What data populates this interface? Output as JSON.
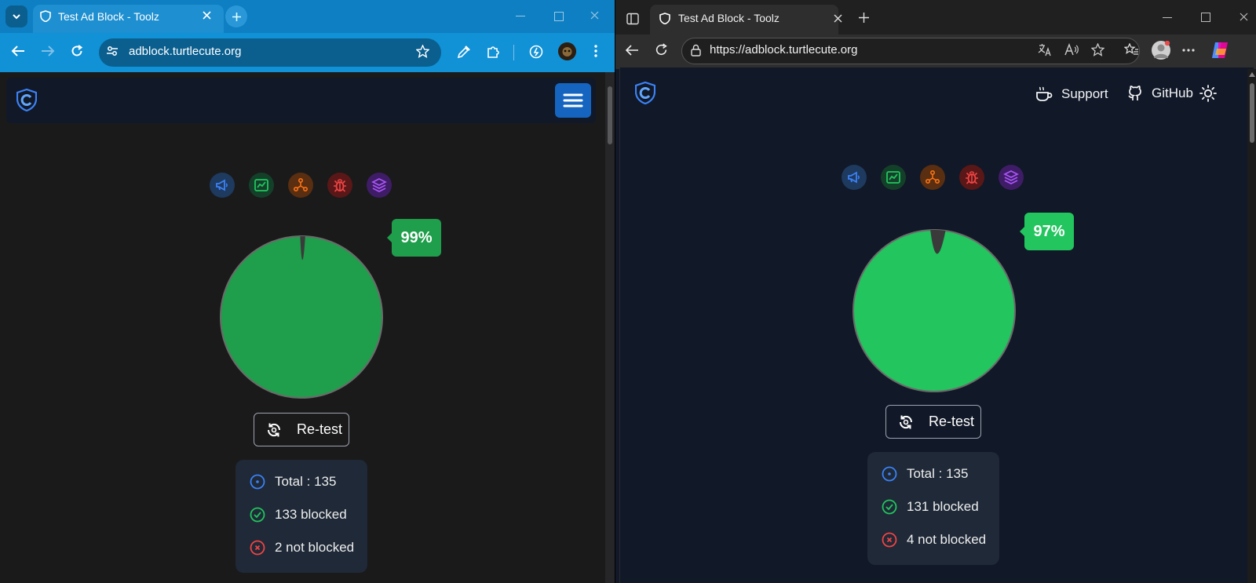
{
  "left_browser": {
    "tab_title": "Test Ad Block - Toolz",
    "url": "adblock.turtlecute.org",
    "result": {
      "percent_label": "99%",
      "percent_blocked": 99
    },
    "retest_label": "Re-test",
    "stats": {
      "total": "Total : 135",
      "blocked": "133 blocked",
      "not_blocked": "2 not blocked"
    }
  },
  "right_browser": {
    "tab_title": "Test Ad Block - Toolz",
    "url": "https://adblock.turtlecute.org",
    "nav": {
      "support": "Support",
      "github": "GitHub"
    },
    "result": {
      "percent_label": "97%",
      "percent_blocked": 97
    },
    "retest_label": "Re-test",
    "stats": {
      "total": "Total : 135",
      "blocked": "131 blocked",
      "not_blocked": "4 not blocked"
    }
  },
  "categories": [
    {
      "icon": "megaphone-icon",
      "color": "#3b82f6",
      "bg": "#1e3a5f"
    },
    {
      "icon": "analytics-chart-icon",
      "color": "#22c55e",
      "bg": "#14402a"
    },
    {
      "icon": "tracker-network-icon",
      "color": "#f97316",
      "bg": "#5a2e10"
    },
    {
      "icon": "bug-icon",
      "color": "#ef4444",
      "bg": "#5a1717"
    },
    {
      "icon": "layers-icon",
      "color": "#a855f7",
      "bg": "#3f1c66"
    }
  ],
  "colors": {
    "chrome_accent": "#0e7fc2",
    "left_pie_green": "#1f9e4b",
    "right_pie_green": "#22c55e",
    "badge_left": "#1f9e4b",
    "badge_right": "#22c55e",
    "blocked_icon": "#22c55e",
    "not_blocked_icon": "#ef4444",
    "total_icon": "#3b82f6"
  }
}
